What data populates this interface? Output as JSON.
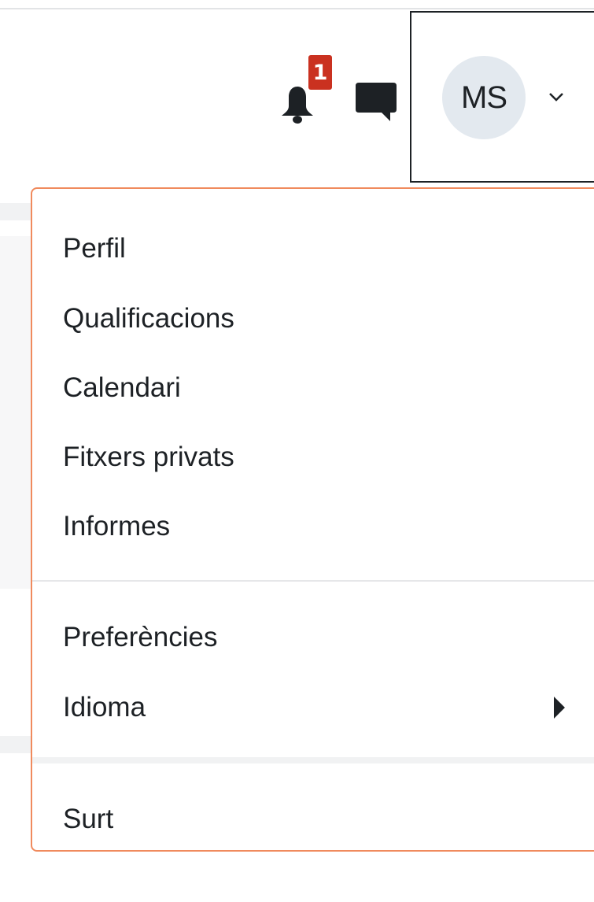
{
  "header": {
    "notifications": {
      "icon": "bell-icon",
      "badge_count": "1"
    },
    "messages": {
      "icon": "chat-icon"
    },
    "user": {
      "initials": "MS",
      "caret_icon": "chevron-down-icon"
    }
  },
  "user_menu": {
    "items": [
      {
        "label": "Perfil"
      },
      {
        "label": "Qualificacions"
      },
      {
        "label": "Calendari"
      },
      {
        "label": "Fitxers privats"
      },
      {
        "label": "Informes"
      },
      {
        "label": "Preferències"
      },
      {
        "label": "Idioma",
        "submenu_icon": "caret-right-icon"
      },
      {
        "label": "Surt"
      }
    ]
  },
  "colors": {
    "badge": "#ca3120",
    "avatar_bg": "#e3e9ef",
    "dropdown_border": "#f08a5d",
    "text": "#1d2125"
  }
}
